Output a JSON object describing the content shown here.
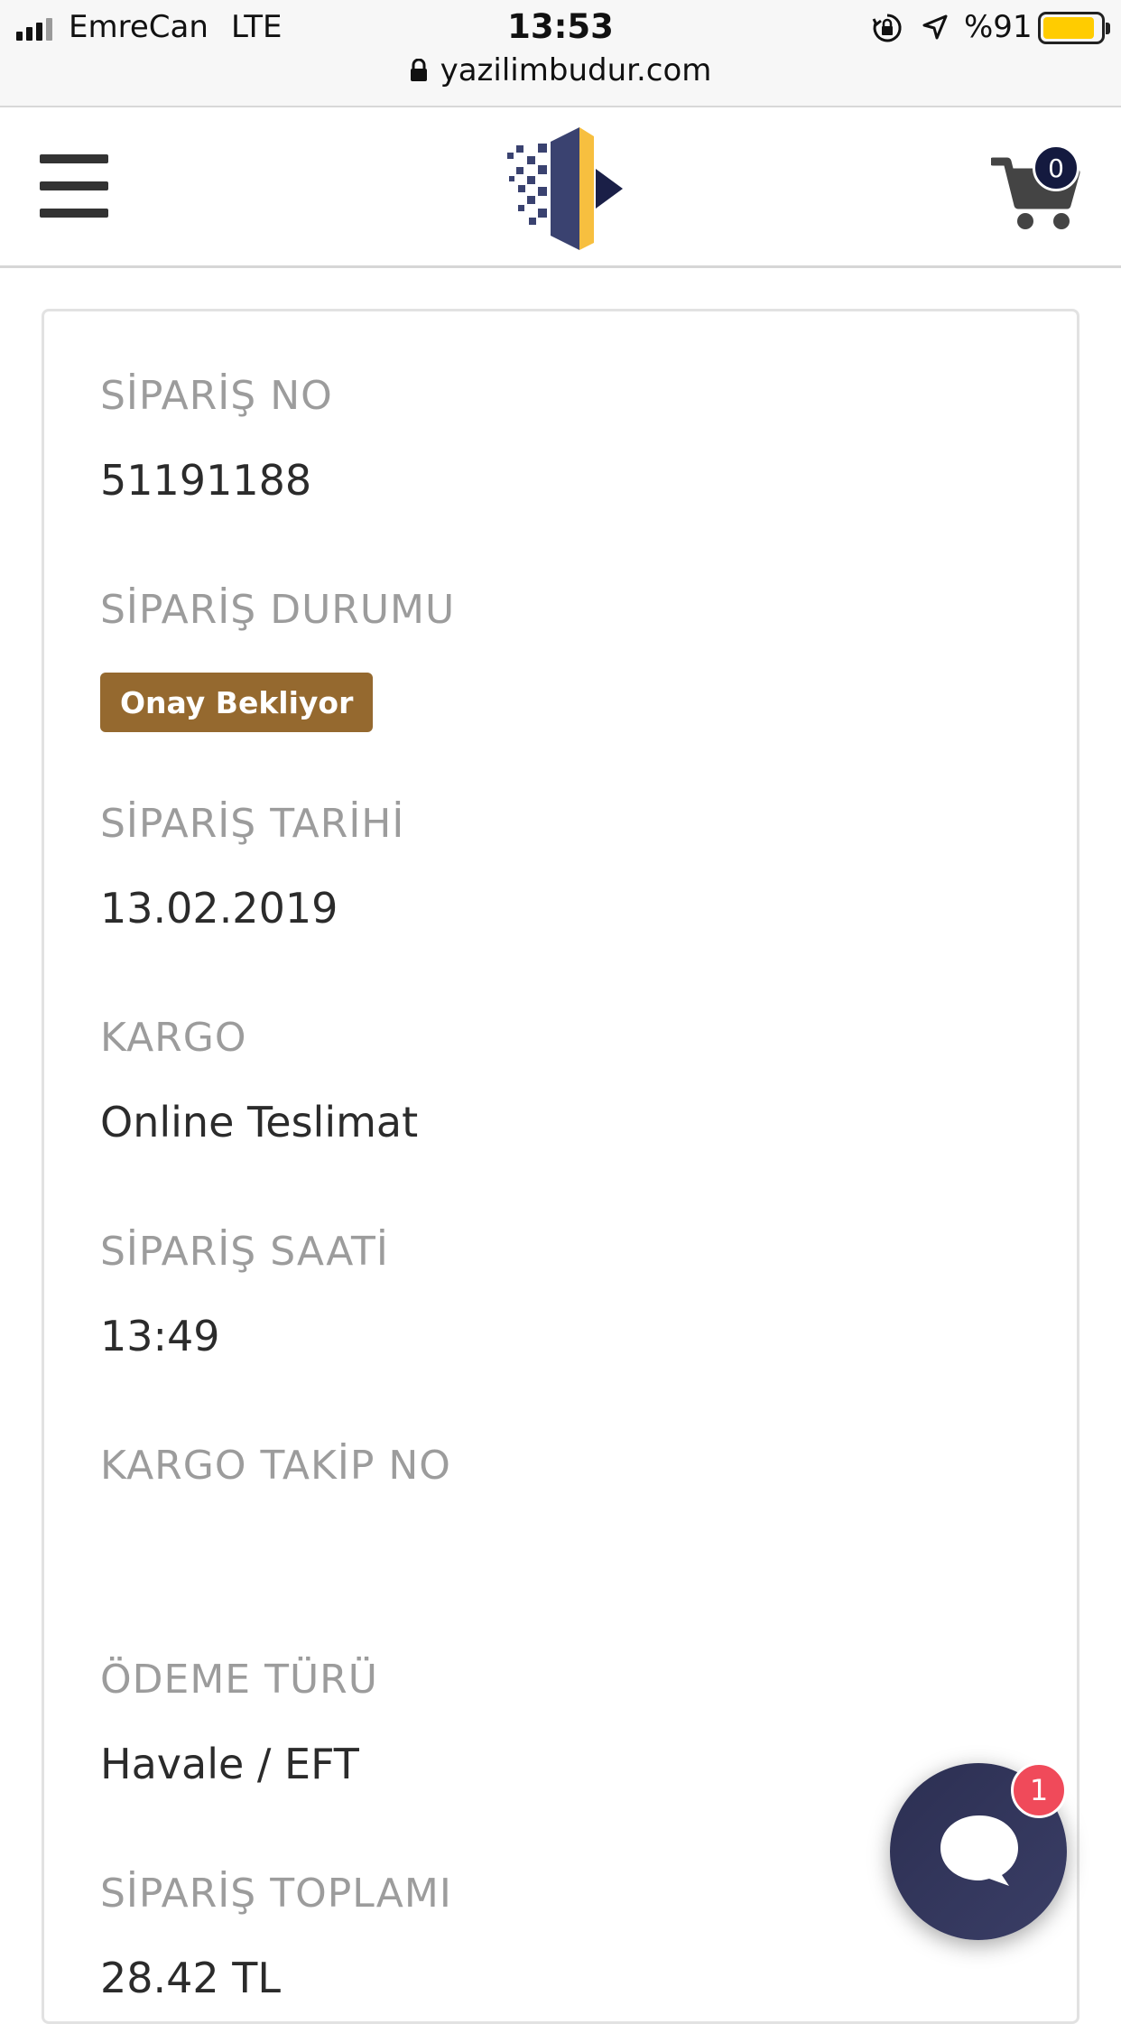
{
  "status_bar": {
    "carrier": "EmreCan",
    "network": "LTE",
    "time": "13:53",
    "battery_percent": "%91",
    "battery_level": 0.91,
    "battery_color": "#ffcc00",
    "icons": [
      "signal-bars-icon",
      "rotation-lock-icon",
      "location-arrow-icon",
      "battery-icon"
    ]
  },
  "browser": {
    "url": "yazilimbudur.com"
  },
  "header": {
    "menu_icon": "hamburger-menu-icon",
    "logo_icon": "yazilimbudur-logo",
    "cart_icon": "shopping-cart-icon",
    "cart_count": "0"
  },
  "order": {
    "fields": [
      {
        "label": "SİPARİŞ NO",
        "value": "51191188"
      },
      {
        "label": "SİPARİŞ DURUMU",
        "value": "Onay Bekliyor",
        "badge_color": "#95692f"
      },
      {
        "label": "SİPARİŞ TARİHİ",
        "value": "13.02.2019"
      },
      {
        "label": "KARGO",
        "value": "Online Teslimat"
      },
      {
        "label": "SİPARİŞ SAATİ",
        "value": "13:49"
      },
      {
        "label": "KARGO TAKİP NO",
        "value": ""
      },
      {
        "label": "ÖDEME TÜRÜ",
        "value": "Havale / EFT"
      },
      {
        "label": "SİPARİŞ TOPLAMI",
        "value": "28.42 TL"
      }
    ]
  },
  "chat": {
    "icon": "chat-bubble-icon",
    "unread_count": "1",
    "badge_color": "#f04a5a"
  }
}
